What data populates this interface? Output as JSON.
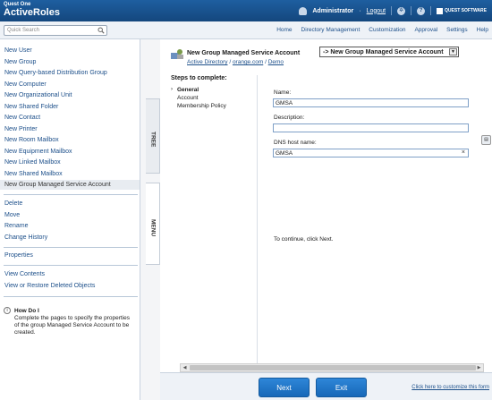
{
  "header": {
    "brand_top": "Quest One",
    "brand_main": "ActiveRoles",
    "user": "Administrator",
    "logout": "Logout",
    "vendor_logo": "QUEST SOFTWARE"
  },
  "search": {
    "placeholder": "Quick Search"
  },
  "nav": [
    "Home",
    "Directory Management",
    "Customization",
    "Approval",
    "Settings",
    "Help"
  ],
  "sidebar": {
    "create_items": [
      "New User",
      "New Group",
      "New Query-based Distribution Group",
      "New Computer",
      "New Organizational Unit",
      "New Shared Folder",
      "New Contact",
      "New Printer",
      "New Room Mailbox",
      "New Equipment Mailbox",
      "New Linked Mailbox",
      "New Shared Mailbox",
      "New Group Managed Service Account"
    ],
    "action_items": [
      "Delete",
      "Move",
      "Rename",
      "Change History"
    ],
    "properties": "Properties",
    "view_items": [
      "View Contents",
      "View or Restore Deleted Objects"
    ],
    "howdo_title": "How Do I",
    "howdo_text": "Complete the pages to specify the properties of the group Managed Service Account to be created."
  },
  "tabs": {
    "tree": "TREE",
    "menu": "MENU"
  },
  "wizard": {
    "title": "New Group Managed Service Account",
    "breadcrumb": [
      "Active Directory",
      "orange.com",
      "Demo"
    ],
    "type_select": "-> New Group Managed Service Account",
    "steps_title": "Steps to complete:",
    "steps": [
      "General",
      "Account",
      "Membership Policy"
    ],
    "fields": {
      "name_label": "Name:",
      "name_value": "GMSA",
      "description_label": "Description:",
      "description_value": "",
      "dns_label": "DNS host name:",
      "dns_value": "GMSA"
    },
    "continue_text": "To continue, click Next.",
    "next_label": "Next",
    "exit_label": "Exit",
    "customize_link": "Click here to customize this form"
  }
}
